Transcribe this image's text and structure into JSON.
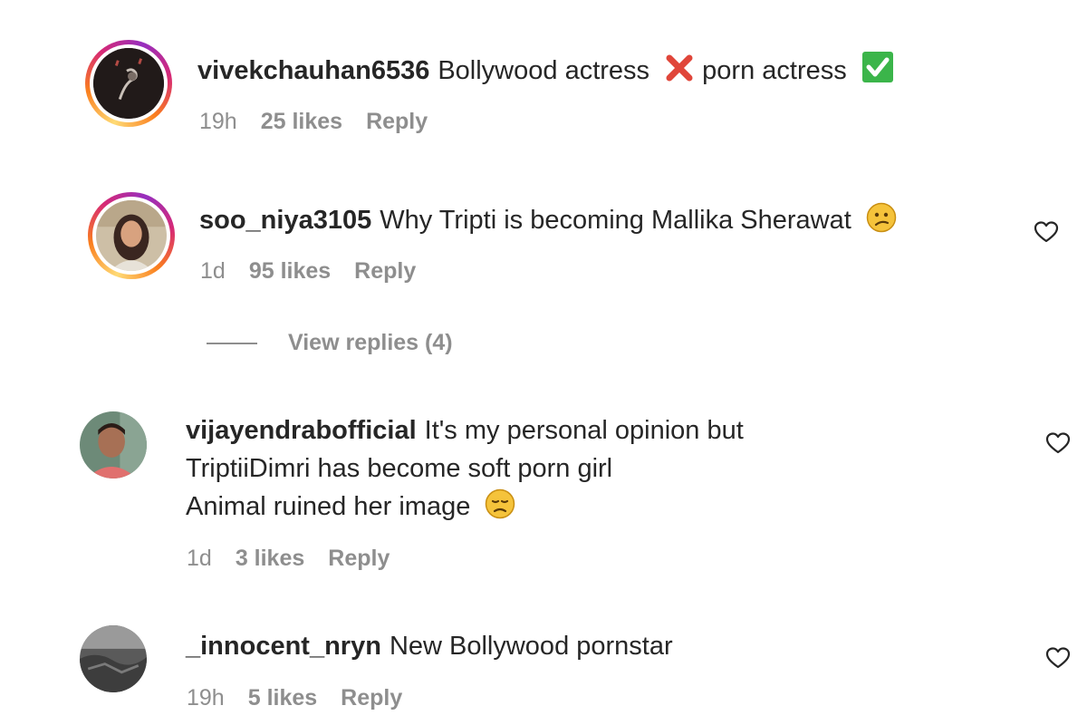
{
  "comments": [
    {
      "username": "vivekchauhan6536",
      "text_parts": [
        "Bollywood actress",
        "porn actress"
      ],
      "emojis": [
        "cross-mark",
        "check-mark-button"
      ],
      "time": "19h",
      "likes": "25 likes",
      "reply": "Reply"
    },
    {
      "username": "soo_niya3105",
      "text": "Why Tripti is becoming Mallika Sherawat",
      "emoji": "confused-face",
      "time": "1d",
      "likes": "95 likes",
      "reply": "Reply",
      "view_replies": "View replies (4)"
    },
    {
      "username": "vijayendrabofficial",
      "lines": [
        "It's my personal opinion but",
        "TriptiiDimri has become soft porn girl",
        "Animal ruined her image"
      ],
      "emoji": "disappointed-face",
      "time": "1d",
      "likes": "3 likes",
      "reply": "Reply"
    },
    {
      "username": "_innocent_nryn",
      "text": "New Bollywood pornstar",
      "time": "19h",
      "likes": "5 likes",
      "reply": "Reply"
    }
  ],
  "colors": {
    "text": "#262626",
    "secondary": "#8e8e8e",
    "cross": "#e0463a",
    "check": "#3bb54a",
    "emoji_face": "#f5c33b"
  }
}
